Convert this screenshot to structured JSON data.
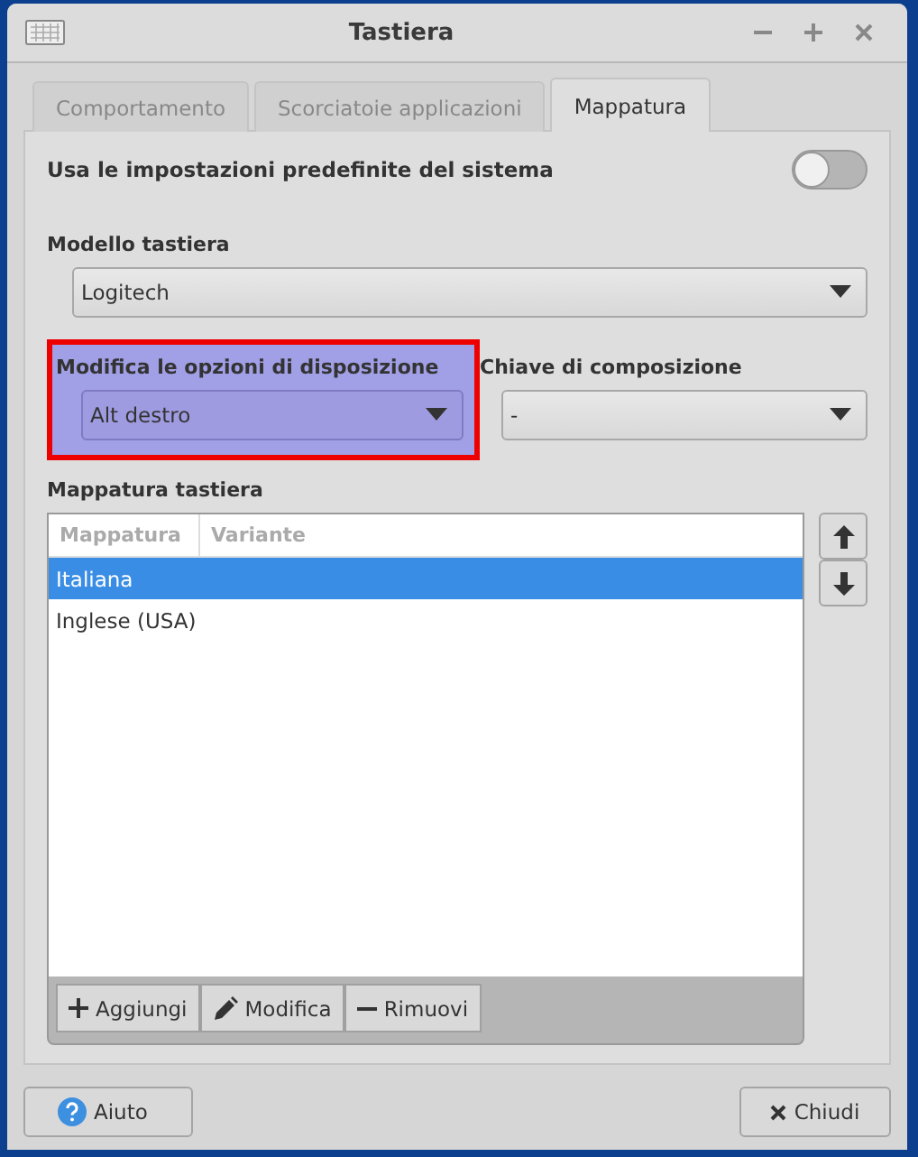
{
  "window": {
    "title": "Tastiera"
  },
  "tabs": [
    {
      "label": "Comportamento",
      "selected": false
    },
    {
      "label": "Scorciatoie applicazioni",
      "selected": false
    },
    {
      "label": "Mappatura",
      "selected": true
    }
  ],
  "system_defaults": {
    "label": "Usa le impostazioni predefinite del sistema",
    "on": false
  },
  "keyboard_model": {
    "label": "Modello tastiera",
    "value": "Logitech"
  },
  "layout_options": {
    "label": "Modifica le opzioni di disposizione",
    "value": "Alt destro",
    "highlighted": true
  },
  "compose_key": {
    "label": "Chiave di composizione",
    "value": "-"
  },
  "layouts": {
    "label": "Mappatura tastiera",
    "columns": [
      "Mappatura",
      "Variante"
    ],
    "rows": [
      {
        "layout": "Italiana",
        "selected": true
      },
      {
        "layout": "Inglese (USA)",
        "selected": false
      }
    ],
    "actions": [
      {
        "kind": "add",
        "label": "Aggiungi"
      },
      {
        "kind": "edit",
        "label": "Modifica"
      },
      {
        "kind": "remove",
        "label": "Rimuovi"
      }
    ]
  },
  "footer": {
    "help": "Aiuto",
    "close": "Chiudi"
  }
}
